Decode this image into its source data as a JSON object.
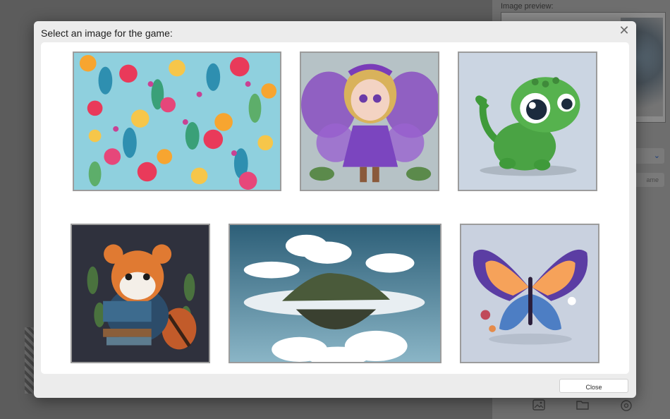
{
  "background": {
    "preview_label": "Image preview:",
    "name_button": "ame",
    "dropdown_chevron": "⌄",
    "bottom_icons": [
      "image-icon",
      "folder-icon",
      "settings-icon"
    ]
  },
  "modal": {
    "title": "Select an image for the game:",
    "close_x": "✕",
    "close_button_label": "Close"
  },
  "gallery": {
    "images": [
      {
        "subject": "flower-pattern",
        "background_color": "#8fd0de"
      },
      {
        "subject": "fairy-girl",
        "background_color": "#b6c2c6"
      },
      {
        "subject": "baby-dragon",
        "background_color": "#cbd5e2"
      },
      {
        "subject": "red-panda-reading",
        "background_color": "#2f313d"
      },
      {
        "subject": "floating-island",
        "background_color": "#3f7a93"
      },
      {
        "subject": "butterfly",
        "background_color": "#c9d1df"
      }
    ]
  },
  "colors": {
    "modal_bg": "#ececec",
    "gallery_bg": "#ffffff",
    "tile_border": "#9c9c9c",
    "overlay": "#5c5c5c"
  }
}
